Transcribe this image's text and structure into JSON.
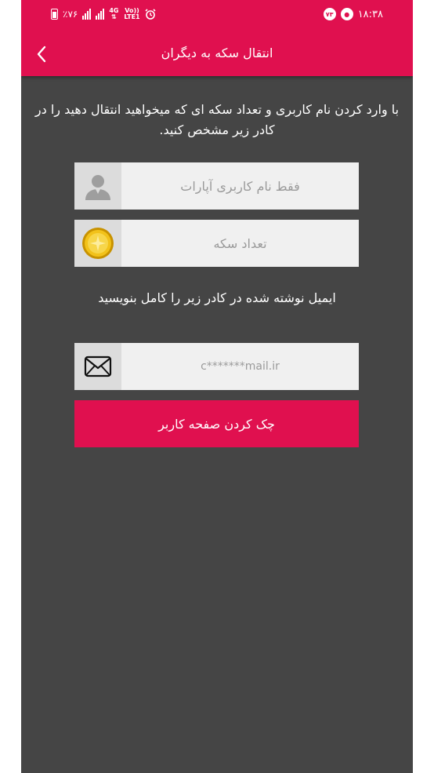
{
  "status_bar": {
    "time": "۱۸:۳۸",
    "notification_badge": "۷۳",
    "battery": "٪۷۶",
    "network_top": "4G",
    "network_bottom": "Vo)) LTE1"
  },
  "header": {
    "title": "انتقال سکه به دیگران"
  },
  "instruction": "با وارد کردن نام کاربری و تعداد سکه ای که میخواهید انتقال دهید را در کادر زیر مشخص کنید.",
  "form": {
    "username_placeholder": "فقط نام کاربری آپارات",
    "coins_placeholder": "تعداد سکه",
    "email_note": "ایمیل نوشته شده در کادر زیر را کامل بنویسید",
    "email_placeholder": "c*******mail.ir",
    "check_button": "چک کردن صفحه کاربر"
  },
  "colors": {
    "accent": "#e0104f",
    "background": "#454545",
    "field_bg": "#f0f0f0"
  },
  "icons": {
    "back": "chevron-left-icon",
    "user": "user-avatar-icon",
    "coin": "coin-icon",
    "email": "envelope-icon"
  }
}
